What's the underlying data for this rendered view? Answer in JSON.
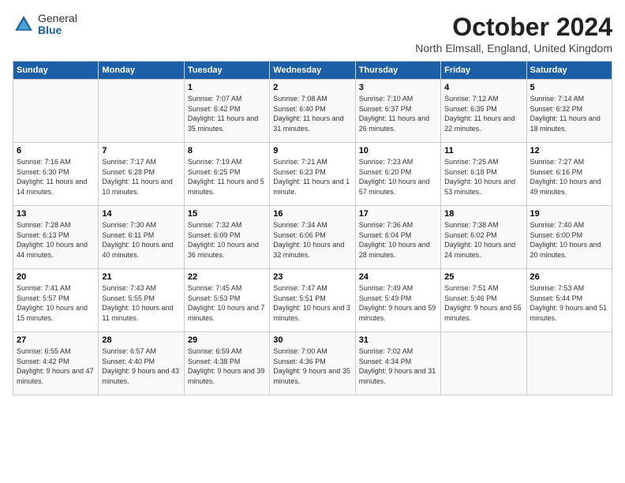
{
  "header": {
    "logo": {
      "general": "General",
      "blue": "Blue"
    },
    "title": "October 2024",
    "location": "North Elmsall, England, United Kingdom"
  },
  "days_of_week": [
    "Sunday",
    "Monday",
    "Tuesday",
    "Wednesday",
    "Thursday",
    "Friday",
    "Saturday"
  ],
  "weeks": [
    [
      {
        "day": "",
        "info": ""
      },
      {
        "day": "",
        "info": ""
      },
      {
        "day": "1",
        "info": "Sunrise: 7:07 AM\nSunset: 6:42 PM\nDaylight: 11 hours and 35 minutes."
      },
      {
        "day": "2",
        "info": "Sunrise: 7:08 AM\nSunset: 6:40 PM\nDaylight: 11 hours and 31 minutes."
      },
      {
        "day": "3",
        "info": "Sunrise: 7:10 AM\nSunset: 6:37 PM\nDaylight: 11 hours and 26 minutes."
      },
      {
        "day": "4",
        "info": "Sunrise: 7:12 AM\nSunset: 6:35 PM\nDaylight: 11 hours and 22 minutes."
      },
      {
        "day": "5",
        "info": "Sunrise: 7:14 AM\nSunset: 6:32 PM\nDaylight: 11 hours and 18 minutes."
      }
    ],
    [
      {
        "day": "6",
        "info": "Sunrise: 7:16 AM\nSunset: 6:30 PM\nDaylight: 11 hours and 14 minutes."
      },
      {
        "day": "7",
        "info": "Sunrise: 7:17 AM\nSunset: 6:28 PM\nDaylight: 11 hours and 10 minutes."
      },
      {
        "day": "8",
        "info": "Sunrise: 7:19 AM\nSunset: 6:25 PM\nDaylight: 11 hours and 5 minutes."
      },
      {
        "day": "9",
        "info": "Sunrise: 7:21 AM\nSunset: 6:23 PM\nDaylight: 11 hours and 1 minute."
      },
      {
        "day": "10",
        "info": "Sunrise: 7:23 AM\nSunset: 6:20 PM\nDaylight: 10 hours and 57 minutes."
      },
      {
        "day": "11",
        "info": "Sunrise: 7:25 AM\nSunset: 6:18 PM\nDaylight: 10 hours and 53 minutes."
      },
      {
        "day": "12",
        "info": "Sunrise: 7:27 AM\nSunset: 6:16 PM\nDaylight: 10 hours and 49 minutes."
      }
    ],
    [
      {
        "day": "13",
        "info": "Sunrise: 7:28 AM\nSunset: 6:13 PM\nDaylight: 10 hours and 44 minutes."
      },
      {
        "day": "14",
        "info": "Sunrise: 7:30 AM\nSunset: 6:11 PM\nDaylight: 10 hours and 40 minutes."
      },
      {
        "day": "15",
        "info": "Sunrise: 7:32 AM\nSunset: 6:09 PM\nDaylight: 10 hours and 36 minutes."
      },
      {
        "day": "16",
        "info": "Sunrise: 7:34 AM\nSunset: 6:06 PM\nDaylight: 10 hours and 32 minutes."
      },
      {
        "day": "17",
        "info": "Sunrise: 7:36 AM\nSunset: 6:04 PM\nDaylight: 10 hours and 28 minutes."
      },
      {
        "day": "18",
        "info": "Sunrise: 7:38 AM\nSunset: 6:02 PM\nDaylight: 10 hours and 24 minutes."
      },
      {
        "day": "19",
        "info": "Sunrise: 7:40 AM\nSunset: 6:00 PM\nDaylight: 10 hours and 20 minutes."
      }
    ],
    [
      {
        "day": "20",
        "info": "Sunrise: 7:41 AM\nSunset: 5:57 PM\nDaylight: 10 hours and 15 minutes."
      },
      {
        "day": "21",
        "info": "Sunrise: 7:43 AM\nSunset: 5:55 PM\nDaylight: 10 hours and 11 minutes."
      },
      {
        "day": "22",
        "info": "Sunrise: 7:45 AM\nSunset: 5:53 PM\nDaylight: 10 hours and 7 minutes."
      },
      {
        "day": "23",
        "info": "Sunrise: 7:47 AM\nSunset: 5:51 PM\nDaylight: 10 hours and 3 minutes."
      },
      {
        "day": "24",
        "info": "Sunrise: 7:49 AM\nSunset: 5:49 PM\nDaylight: 9 hours and 59 minutes."
      },
      {
        "day": "25",
        "info": "Sunrise: 7:51 AM\nSunset: 5:46 PM\nDaylight: 9 hours and 55 minutes."
      },
      {
        "day": "26",
        "info": "Sunrise: 7:53 AM\nSunset: 5:44 PM\nDaylight: 9 hours and 51 minutes."
      }
    ],
    [
      {
        "day": "27",
        "info": "Sunrise: 6:55 AM\nSunset: 4:42 PM\nDaylight: 9 hours and 47 minutes."
      },
      {
        "day": "28",
        "info": "Sunrise: 6:57 AM\nSunset: 4:40 PM\nDaylight: 9 hours and 43 minutes."
      },
      {
        "day": "29",
        "info": "Sunrise: 6:59 AM\nSunset: 4:38 PM\nDaylight: 9 hours and 39 minutes."
      },
      {
        "day": "30",
        "info": "Sunrise: 7:00 AM\nSunset: 4:36 PM\nDaylight: 9 hours and 35 minutes."
      },
      {
        "day": "31",
        "info": "Sunrise: 7:02 AM\nSunset: 4:34 PM\nDaylight: 9 hours and 31 minutes."
      },
      {
        "day": "",
        "info": ""
      },
      {
        "day": "",
        "info": ""
      }
    ]
  ]
}
